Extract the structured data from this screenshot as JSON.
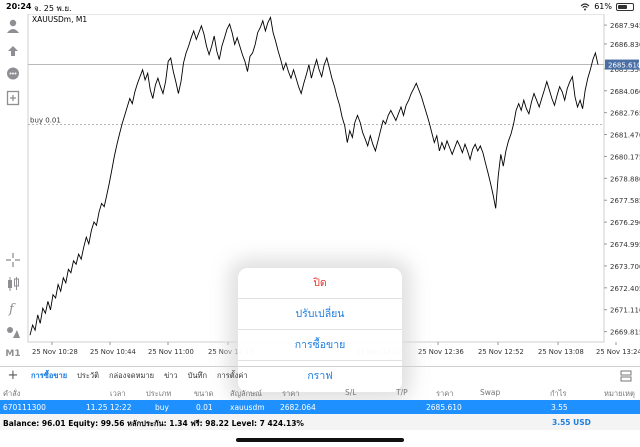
{
  "status_bar": {
    "time": "20:24",
    "date": "จ. 25 พ.ย.",
    "battery": "61%",
    "battery_level": 0.61
  },
  "chart": {
    "symbol_label": "XAUUSDm, M1",
    "order_line_label": "buy 0.01",
    "current_price_label": "2685.610",
    "colors": {
      "price_line": "#000000",
      "order_line": "#9e9e9e",
      "price_tag_bg": "#4a6fa5",
      "grid": "#e8e8e8"
    }
  },
  "chart_data": {
    "type": "line",
    "title": "XAUUSDm, M1",
    "x_tick_labels": [
      "25 Nov 10:28",
      "25 Nov 10:44",
      "25 Nov 11:00",
      "25 Nov 11:16",
      "25 Nov 12:20",
      "25 Nov 12:36",
      "25 Nov 12:52",
      "25 Nov 13:08",
      "25 Nov 13:24"
    ],
    "y_tick_labels": [
      "2687.945",
      "2686.830",
      "2685.350",
      "2684.060",
      "2682.765",
      "2681.470",
      "2680.175",
      "2678.880",
      "2677.585",
      "2676.290",
      "2674.995",
      "2673.700",
      "2672.405",
      "2671.110",
      "2669.815"
    ],
    "ylim": [
      2669.2,
      2688.6
    ],
    "current_price": 2685.61,
    "order_price": 2682.064,
    "series": [
      {
        "values": [
          2669.6,
          2670.2,
          2669.9,
          2670.8,
          2670.3,
          2671.2,
          2670.9,
          2671.6,
          2671.1,
          2672.0,
          2671.8,
          2672.6,
          2672.2,
          2673.0,
          2672.7,
          2673.5,
          2673.3,
          2674.0,
          2673.8,
          2674.4,
          2674.1,
          2674.8,
          2675.4,
          2675.0,
          2675.8,
          2676.3,
          2676.1,
          2676.9,
          2677.4,
          2677.2,
          2677.9,
          2678.6,
          2679.4,
          2680.2,
          2680.9,
          2681.5,
          2682.1,
          2682.6,
          2683.1,
          2683.6,
          2683.3,
          2684.0,
          2684.5,
          2684.9,
          2685.3,
          2684.7,
          2685.1,
          2684.1,
          2683.6,
          2684.4,
          2684.8,
          2684.3,
          2683.9,
          2684.6,
          2685.8,
          2686.0,
          2685.2,
          2684.6,
          2683.9,
          2684.6,
          2685.7,
          2686.3,
          2686.7,
          2687.2,
          2687.6,
          2687.1,
          2687.5,
          2687.9,
          2687.4,
          2686.7,
          2686.2,
          2686.7,
          2687.3,
          2686.4,
          2685.9,
          2686.7,
          2687.2,
          2687.7,
          2688.0,
          2687.5,
          2686.8,
          2687.2,
          2686.7,
          2686.2,
          2685.8,
          2685.2,
          2686.1,
          2686.3,
          2686.8,
          2687.5,
          2687.8,
          2688.2,
          2687.6,
          2688.1,
          2688.4,
          2687.5,
          2687.0,
          2686.4,
          2685.9,
          2685.3,
          2685.7,
          2685.2,
          2684.8,
          2685.3,
          2684.8,
          2684.3,
          2683.9,
          2684.5,
          2685.0,
          2685.6,
          2684.8,
          2685.4,
          2685.9,
          2685.3,
          2684.9,
          2685.6,
          2686.0,
          2685.4,
          2684.8,
          2684.3,
          2683.7,
          2683.2,
          2682.5,
          2682.0,
          2681.0,
          2681.7,
          2681.3,
          2682.2,
          2682.6,
          2682.2,
          2681.6,
          2681.2,
          2680.8,
          2681.4,
          2680.9,
          2680.5,
          2681.1,
          2681.7,
          2682.3,
          2682.1,
          2682.6,
          2682.9,
          2682.6,
          2682.3,
          2682.7,
          2683.1,
          2682.6,
          2683.2,
          2683.5,
          2683.9,
          2684.2,
          2684.5,
          2684.1,
          2683.7,
          2683.2,
          2682.7,
          2682.2,
          2681.6,
          2681.0,
          2681.4,
          2680.5,
          2681.0,
          2680.6,
          2681.1,
          2680.7,
          2680.3,
          2680.7,
          2681.1,
          2680.8,
          2680.4,
          2680.9,
          2680.5,
          2680.0,
          2680.6,
          2680.9,
          2680.5,
          2680.8,
          2680.4,
          2679.8,
          2679.2,
          2678.6,
          2677.9,
          2677.1,
          2679.0,
          2680.3,
          2679.6,
          2680.5,
          2681.1,
          2681.5,
          2682.1,
          2682.9,
          2683.3,
          2682.9,
          2683.5,
          2683.0,
          2682.7,
          2683.4,
          2683.9,
          2683.5,
          2683.1,
          2683.6,
          2684.1,
          2684.6,
          2684.1,
          2683.6,
          2683.2,
          2683.8,
          2684.3,
          2684.0,
          2683.5,
          2684.2,
          2684.6,
          2684.9,
          2683.7,
          2683.1,
          2683.5,
          2683.0,
          2684.1,
          2684.8,
          2685.3,
          2685.9,
          2686.3,
          2685.6
        ]
      }
    ]
  },
  "popover": {
    "items": [
      "ปิด",
      "ปรับเปลี่ยน",
      "การซื้อขาย",
      "กราฟ"
    ]
  },
  "tabs": [
    "การซื้อขาย",
    "ประวัติ",
    "กล่องจดหมาย",
    "ข่าว",
    "บันทึก",
    "การตั้งค่า"
  ],
  "table": {
    "headers": [
      "คำสั่ง",
      "เวลา",
      "ประเภท",
      "ขนาด",
      "สัญลักษณ์",
      "ราคา",
      "S/L",
      "T/P",
      "ราคา",
      "Swap",
      "กำไร",
      "หมายเหตุ"
    ],
    "row": {
      "ticket": "670111300",
      "time": "11.25 12:22",
      "type": "buy",
      "size": "0.01",
      "symbol": "xauusdm",
      "open_price": "2682.064",
      "current_price": "2685.610",
      "profit": "3.55"
    }
  },
  "balance": {
    "text": "Balance: 96.01  Equity: 99.56  หลักประกัน: 1.34  ฟรี: 98.22  Level: 7 424.13%",
    "profit_total": "3.55  USD"
  }
}
